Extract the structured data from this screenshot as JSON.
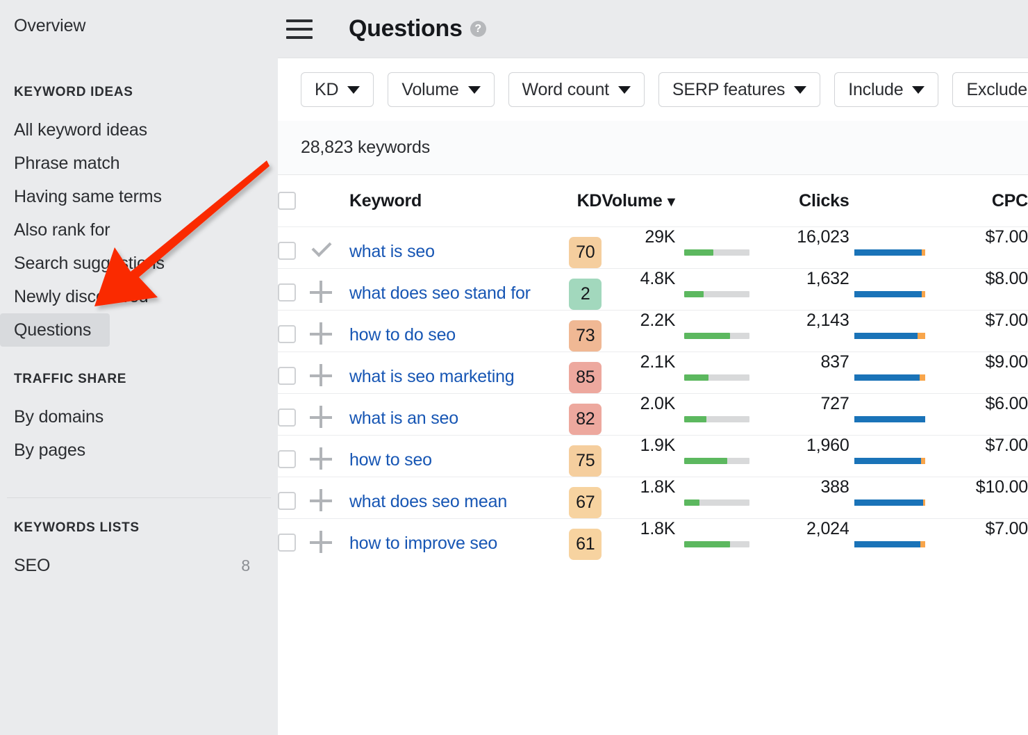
{
  "sidebar": {
    "overview_label": "Overview",
    "groups": [
      {
        "title": "KEYWORD IDEAS",
        "items": [
          {
            "label": "All keyword ideas",
            "count": "",
            "active": false
          },
          {
            "label": "Phrase match",
            "count": "",
            "active": false
          },
          {
            "label": "Having same terms",
            "count": "",
            "active": false
          },
          {
            "label": "Also rank for",
            "count": "",
            "active": false
          },
          {
            "label": "Search suggestions",
            "count": "",
            "active": false
          },
          {
            "label": "Newly discovered",
            "count": "",
            "active": false
          },
          {
            "label": "Questions",
            "count": "",
            "active": true
          }
        ]
      },
      {
        "title": "TRAFFIC SHARE",
        "items": [
          {
            "label": "By domains",
            "count": "",
            "active": false
          },
          {
            "label": "By pages",
            "count": "",
            "active": false
          }
        ]
      },
      {
        "title": "KEYWORDS LISTS",
        "items": [
          {
            "label": "SEO",
            "count": "8",
            "active": false
          }
        ]
      }
    ]
  },
  "header": {
    "menu_icon": "hamburger-icon",
    "title": "Questions",
    "help_icon": "question-mark-icon",
    "help_glyph": "?"
  },
  "filters": [
    {
      "label": "KD"
    },
    {
      "label": "Volume"
    },
    {
      "label": "Word count"
    },
    {
      "label": "SERP features"
    },
    {
      "label": "Include"
    },
    {
      "label": "Exclude"
    }
  ],
  "results": {
    "count_text": "28,823 keywords"
  },
  "table": {
    "headers": {
      "keyword": "Keyword",
      "kd": "KD",
      "volume": "Volume",
      "volume_sort": "▼",
      "clicks": "Clicks",
      "cpc": "CPC"
    },
    "rows": [
      {
        "action_icon": "check-icon",
        "keyword": "what is seo",
        "kd": "70",
        "kd_color": "#f5ce9e",
        "volume": "29K",
        "volume_pct": 44,
        "clicks": "16,023",
        "clicks_blue_pct": 96,
        "clicks_orange_pct": 4,
        "cpc": "$7.00"
      },
      {
        "action_icon": "plus-icon",
        "keyword": "what does seo stand for",
        "kd": "2",
        "kd_color": "#a2d8bd",
        "volume": "4.8K",
        "volume_pct": 30,
        "clicks": "1,632",
        "clicks_blue_pct": 96,
        "clicks_orange_pct": 4,
        "cpc": "$8.00"
      },
      {
        "action_icon": "plus-icon",
        "keyword": "how to do seo",
        "kd": "73",
        "kd_color": "#f0b894",
        "volume": "2.2K",
        "volume_pct": 70,
        "clicks": "2,143",
        "clicks_blue_pct": 90,
        "clicks_orange_pct": 10,
        "cpc": "$7.00"
      },
      {
        "action_icon": "plus-icon",
        "keyword": "what is seo marketing",
        "kd": "85",
        "kd_color": "#eda89e",
        "volume": "2.1K",
        "volume_pct": 37,
        "clicks": "837",
        "clicks_blue_pct": 93,
        "clicks_orange_pct": 7,
        "cpc": "$9.00"
      },
      {
        "action_icon": "plus-icon",
        "keyword": "what is an seo",
        "kd": "82",
        "kd_color": "#eda89e",
        "volume": "2.0K",
        "volume_pct": 34,
        "clicks": "727",
        "clicks_blue_pct": 100,
        "clicks_orange_pct": 0,
        "cpc": "$6.00"
      },
      {
        "action_icon": "plus-icon",
        "keyword": "how to seo",
        "kd": "75",
        "kd_color": "#f5ce9e",
        "volume": "1.9K",
        "volume_pct": 66,
        "clicks": "1,960",
        "clicks_blue_pct": 95,
        "clicks_orange_pct": 5,
        "cpc": "$7.00"
      },
      {
        "action_icon": "plus-icon",
        "keyword": "what does seo mean",
        "kd": "67",
        "kd_color": "#f7d3a0",
        "volume": "1.8K",
        "volume_pct": 23,
        "clicks": "388",
        "clicks_blue_pct": 97,
        "clicks_orange_pct": 3,
        "cpc": "$10.00"
      },
      {
        "action_icon": "plus-icon",
        "keyword": "how to improve seo",
        "kd": "61",
        "kd_color": "#f7d3a0",
        "volume": "1.8K",
        "volume_pct": 70,
        "clicks": "2,024",
        "clicks_blue_pct": 94,
        "clicks_orange_pct": 6,
        "cpc": "$7.00"
      }
    ]
  },
  "annotation": {
    "arrow_color": "#fa2a05",
    "arrow_name": "red-pointer-arrow"
  }
}
